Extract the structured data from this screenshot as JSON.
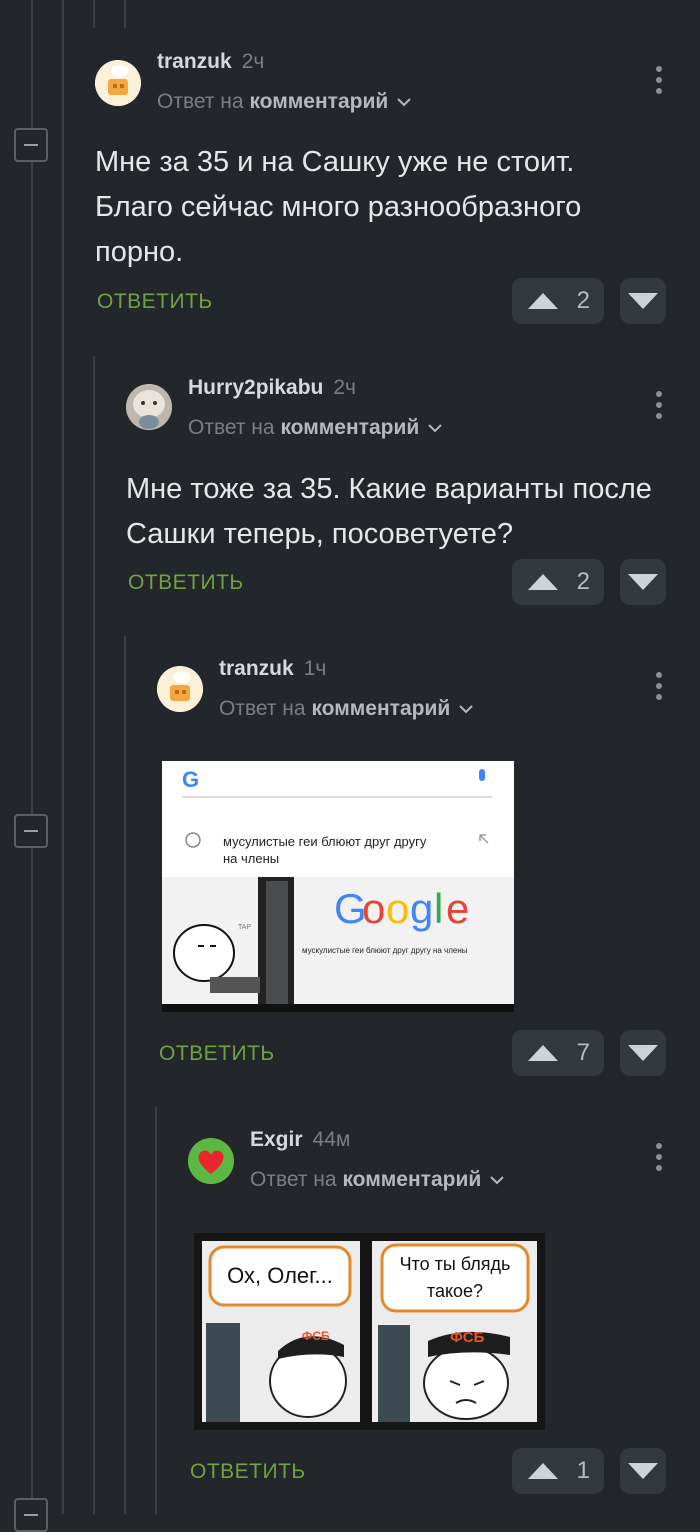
{
  "labels": {
    "reply_prefix": "Ответ на",
    "reply_target": "комментарий",
    "reply_action": "ОТВЕТИТЬ"
  },
  "comments": [
    {
      "user": "tranzuk",
      "time": "2ч",
      "text": "Мне за 35 и на Сашку уже не стоит. Благо сейчас много разнообразного порно.",
      "votes": "2"
    },
    {
      "user": "Hurry2pikabu",
      "time": "2ч",
      "text": "Мне тоже за 35. Какие варианты после Сашки теперь, посоветуете?",
      "votes": "2"
    },
    {
      "user": "tranzuk",
      "time": "1ч",
      "image": {
        "search_query": "мусулистые геи блюют друг другу на члены",
        "google_logo": "Google",
        "google_query": "мускулистые геи блюют друг другу на члены",
        "tap_label": "TAP"
      },
      "votes": "7"
    },
    {
      "user": "Exgir",
      "time": "44м",
      "image": {
        "bubble_left": "Ох, Олег...",
        "bubble_right": "Что ты блядь такое?",
        "cap_left": "ФСБ",
        "cap_right": "ФСБ"
      },
      "votes": "1"
    }
  ],
  "colors": {
    "background": "#23272b",
    "accent_green": "#6fa341",
    "vote_bg": "#34393f"
  }
}
